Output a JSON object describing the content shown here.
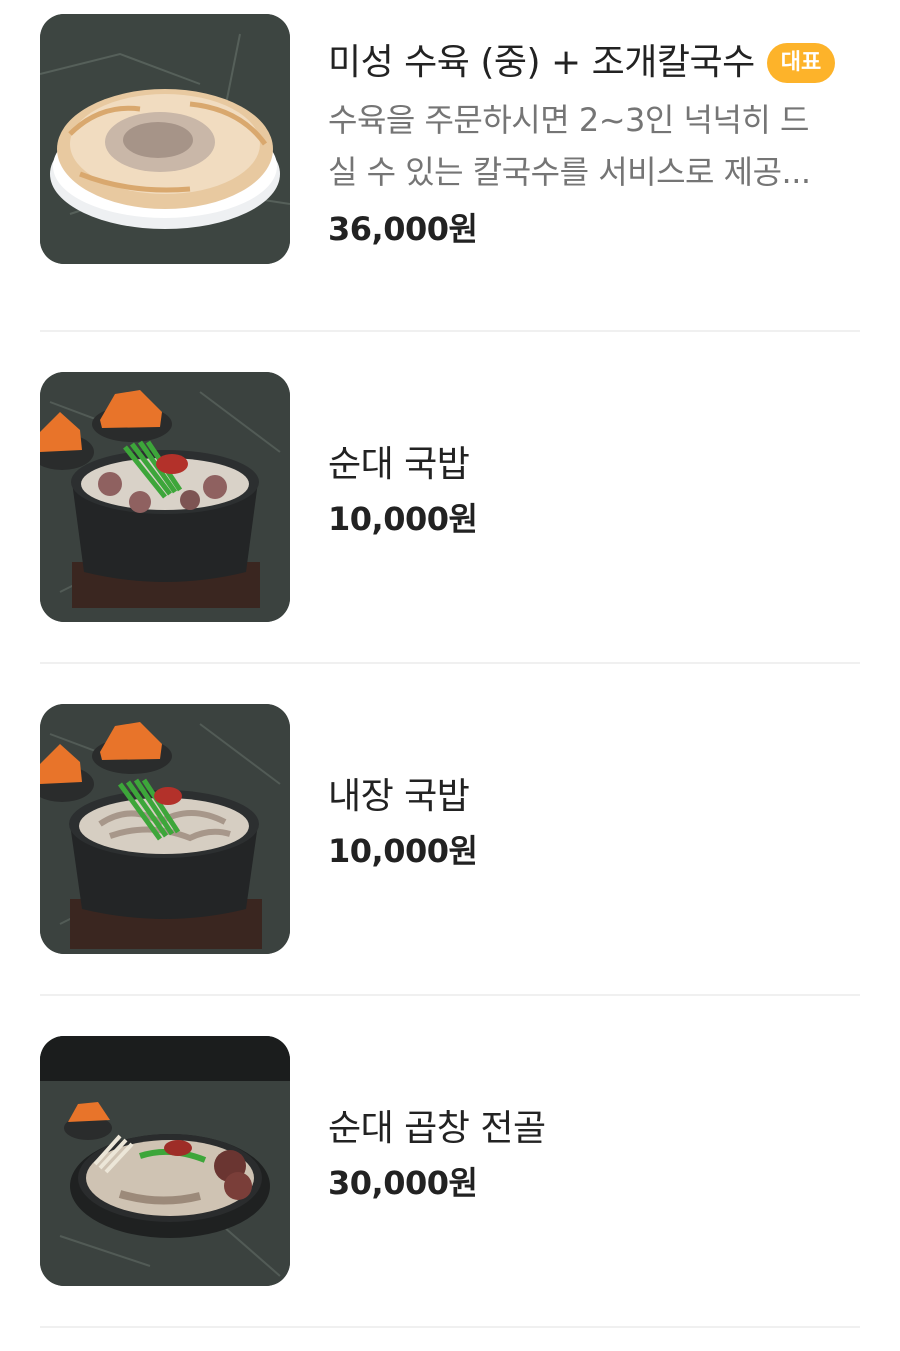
{
  "menu": {
    "items": [
      {
        "name": "미성 수육 (중) + 조개칼국수",
        "badge": "대표",
        "description_line1": "수육을 주문하시면 2~3인 넉넉히 드",
        "description_line2": "실 수 있는 칼국수를 서비스로 제공...",
        "price": "36,000원",
        "image_icon": "boiled-pork-plate"
      },
      {
        "name": "순대 국밥",
        "price": "10,000원",
        "image_icon": "sundae-gukbap-bowl"
      },
      {
        "name": "내장 국밥",
        "price": "10,000원",
        "image_icon": "naejang-gukbap-bowl"
      },
      {
        "name": "순대 곱창 전골",
        "price": "30,000원",
        "image_icon": "sundae-gopchang-hotpot"
      }
    ]
  }
}
